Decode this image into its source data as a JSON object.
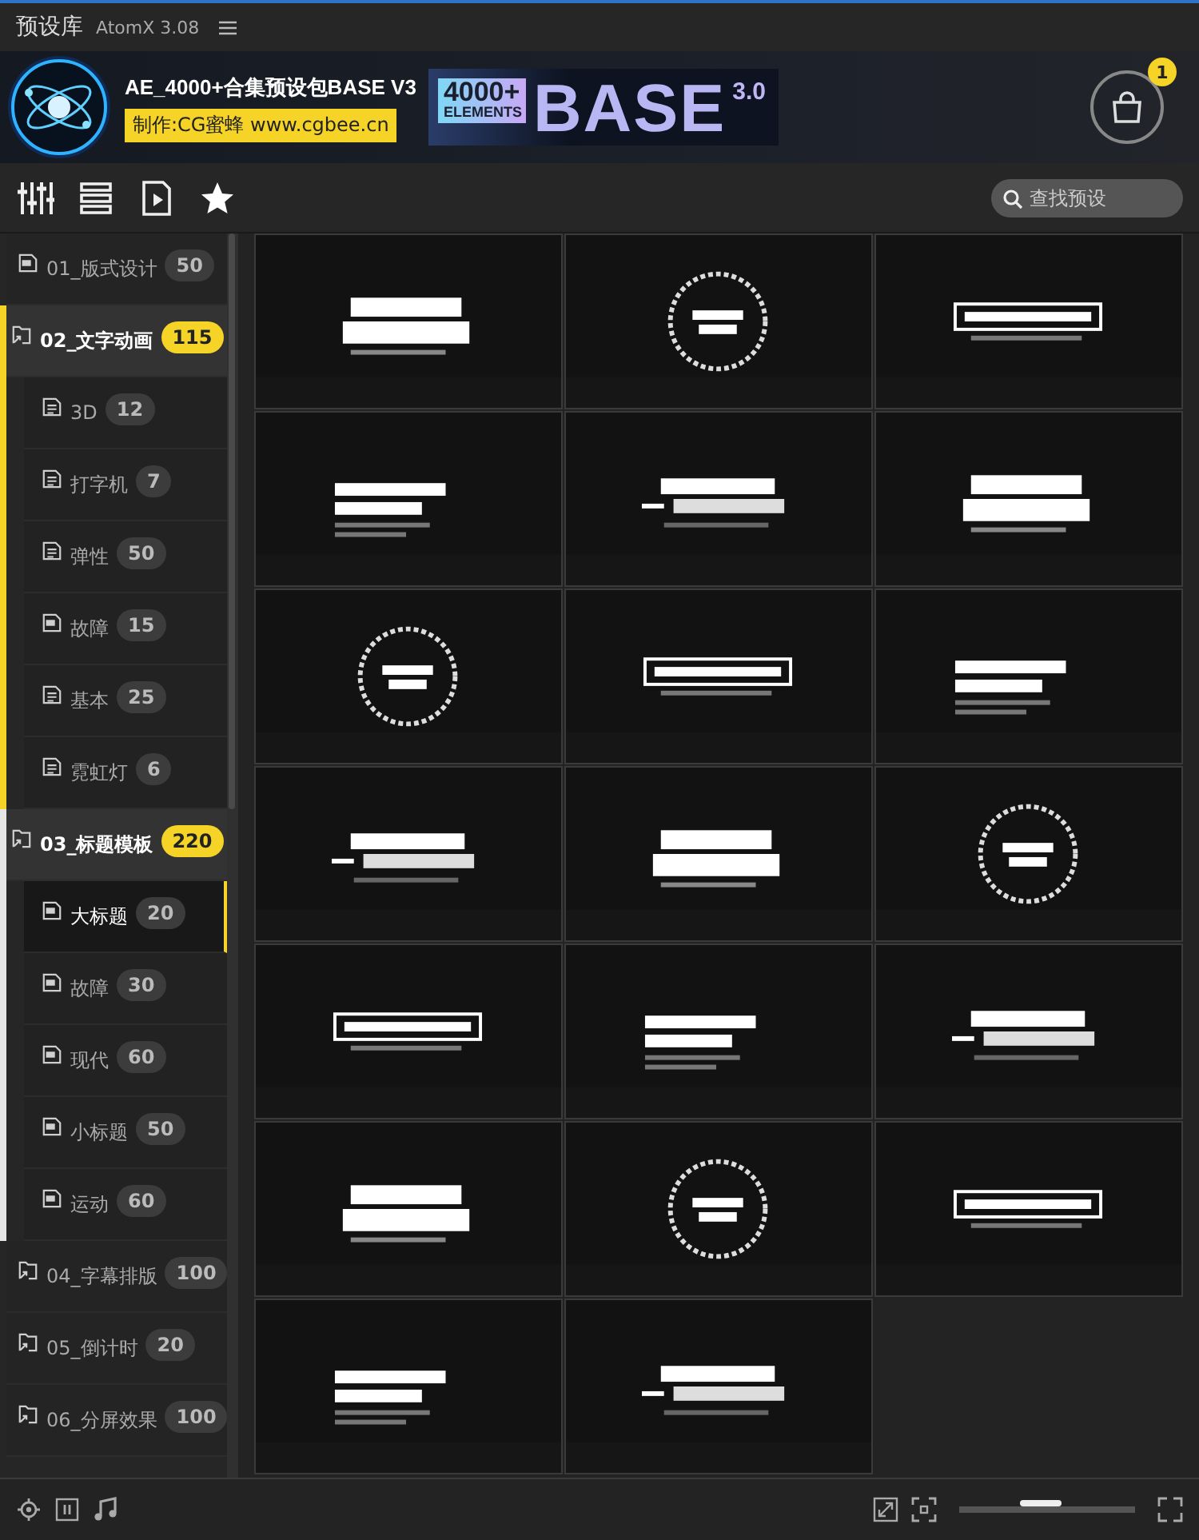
{
  "window": {
    "title": "预设库",
    "version": "AtomX 3.08"
  },
  "banner": {
    "title": "AE_4000+合集预设包BASE V3",
    "credit": "制作:CG蜜蜂 www.cgbee.cn",
    "art": {
      "count": "4000+",
      "unit": "ELEMENTS",
      "word": "BASE",
      "version": "3.0"
    },
    "cart_count": "1"
  },
  "search": {
    "placeholder": "查找预设"
  },
  "sidebar": {
    "items": [
      {
        "kind": "ae",
        "label": "01_版式设计",
        "count": "50",
        "expanded": false
      },
      {
        "kind": "folder",
        "label": "02_文字动画",
        "count": "115",
        "expanded": true,
        "color": "#f5d327",
        "children": [
          {
            "kind": "doc",
            "label": "3D",
            "count": "12",
            "selected": false
          },
          {
            "kind": "doc",
            "label": "打字机",
            "count": "7",
            "selected": false
          },
          {
            "kind": "doc",
            "label": "弹性",
            "count": "50",
            "selected": false
          },
          {
            "kind": "ae",
            "label": "故障",
            "count": "15",
            "selected": false
          },
          {
            "kind": "doc",
            "label": "基本",
            "count": "25",
            "selected": false
          },
          {
            "kind": "doc",
            "label": "霓虹灯",
            "count": "6",
            "selected": false
          }
        ]
      },
      {
        "kind": "folder",
        "label": "03_标题模板",
        "count": "220",
        "expanded": true,
        "color": "#e6e6e6",
        "children": [
          {
            "kind": "ae",
            "label": "大标题",
            "count": "20",
            "selected": true
          },
          {
            "kind": "ae",
            "label": "故障",
            "count": "30",
            "selected": false
          },
          {
            "kind": "ae",
            "label": "现代",
            "count": "60",
            "selected": false
          },
          {
            "kind": "ae",
            "label": "小标题",
            "count": "50",
            "selected": false
          },
          {
            "kind": "ae",
            "label": "运动",
            "count": "60",
            "selected": false
          }
        ]
      },
      {
        "kind": "folder",
        "label": "04_字幕排版",
        "count": "100",
        "expanded": false
      },
      {
        "kind": "folder",
        "label": "05_倒计时",
        "count": "20",
        "expanded": false
      },
      {
        "kind": "folder",
        "label": "06_分屏效果",
        "count": "100",
        "expanded": false
      }
    ]
  },
  "size_slider": {
    "level": 0.45
  }
}
